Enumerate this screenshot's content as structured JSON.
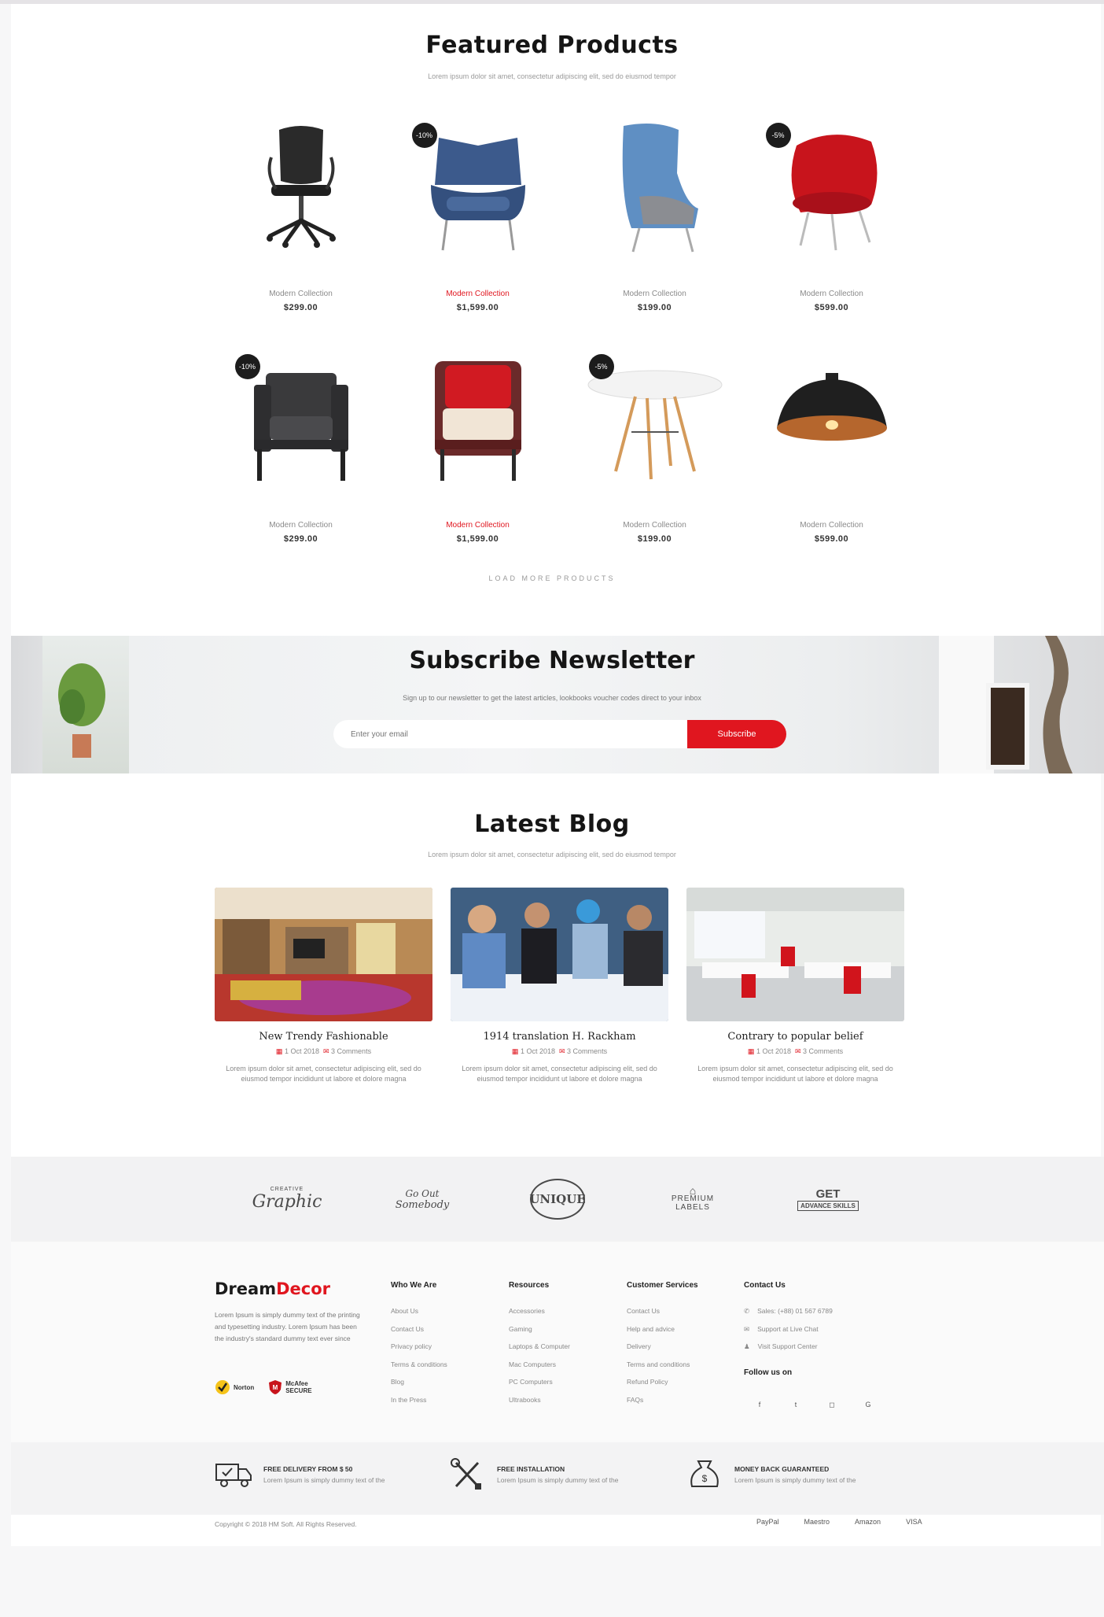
{
  "featured": {
    "title": "Featured Products",
    "subtitle": "Lorem ipsum dolor sit amet, consectetur adipiscing elit, sed do eiusmod tempor",
    "products": [
      {
        "name": "Modern Collection",
        "price": "$299.00",
        "badge": "",
        "highlight": false,
        "icon": "office-chair"
      },
      {
        "name": "Modern Collection",
        "price": "$1,599.00",
        "badge": "-10%",
        "highlight": true,
        "icon": "blue-wingback-chair"
      },
      {
        "name": "Modern Collection",
        "price": "$199.00",
        "badge": "",
        "highlight": false,
        "icon": "blue-egg-chair"
      },
      {
        "name": "Modern Collection",
        "price": "$599.00",
        "badge": "-5%",
        "highlight": false,
        "icon": "red-womb-chair"
      },
      {
        "name": "Modern Collection",
        "price": "$299.00",
        "badge": "-10%",
        "highlight": false,
        "icon": "leather-armchair"
      },
      {
        "name": "Modern Collection",
        "price": "$1,599.00",
        "badge": "",
        "highlight": true,
        "icon": "red-upholstered-armchair"
      },
      {
        "name": "Modern Collection",
        "price": "$199.00",
        "badge": "-5%",
        "highlight": false,
        "icon": "white-round-table"
      },
      {
        "name": "Modern Collection",
        "price": "$599.00",
        "badge": "",
        "highlight": false,
        "icon": "pendant-lamp"
      }
    ],
    "load_more": "LOAD MORE PRODUCTS"
  },
  "newsletter": {
    "title": "Subscribe Newsletter",
    "subtitle": "Sign up to our newsletter to get the latest articles, lookbooks voucher codes direct to your inbox",
    "placeholder": "Enter your email",
    "button": "Subscribe"
  },
  "blog": {
    "title": "Latest Blog",
    "subtitle": "Lorem ipsum dolor sit amet, consectetur adipiscing elit, sed do eiusmod tempor",
    "posts": [
      {
        "title": "New Trendy Fashionable",
        "date": "1 Oct 2018",
        "comments": "3 Comments",
        "excerpt": "Lorem ipsum dolor sit amet, consectetur adipiscing elit, sed do eiusmod tempor incididunt ut labore et dolore magna"
      },
      {
        "title": "1914 translation H. Rackham",
        "date": "1 Oct 2018",
        "comments": "3 Comments",
        "excerpt": "Lorem ipsum dolor sit amet, consectetur adipiscing elit, sed do eiusmod tempor incididunt ut labore et dolore magna"
      },
      {
        "title": "Contrary to popular belief",
        "date": "1 Oct 2018",
        "comments": "3 Comments",
        "excerpt": "Lorem ipsum dolor sit amet, consectetur adipiscing elit, sed do eiusmod tempor incididunt ut labore et dolore magna"
      }
    ]
  },
  "brands": [
    {
      "top": "CREATIVE",
      "main": "Graphic"
    },
    {
      "top": "Go Out",
      "main": "Somebody"
    },
    {
      "top": "",
      "main": "UNIQUE"
    },
    {
      "top": "",
      "main": "PREMIUM LABELS"
    },
    {
      "top": "GET",
      "main": "ADVANCE SKILLS"
    }
  ],
  "footer": {
    "logo_main": "Dream",
    "logo_accent": "Decor",
    "about": "Lorem Ipsum is simply dummy text of the printing and typesetting industry. Lorem Ipsum has been the industry's standard dummy text ever since",
    "seal_norton": "Norton",
    "seal_mcafee": "McAfee SECURE",
    "columns": [
      {
        "title": "Who We Are",
        "links": [
          "About Us",
          "Contact Us",
          "Privacy policy",
          "Terms & conditions",
          "Blog",
          "In the Press"
        ]
      },
      {
        "title": "Resources",
        "links": [
          "Accessories",
          "Gaming",
          "Laptops & Computer",
          "Mac Computers",
          "PC Computers",
          "Ultrabooks"
        ]
      },
      {
        "title": "Customer Services",
        "links": [
          "Contact Us",
          "Help and advice",
          "Delivery",
          "Terms and conditions",
          "Refund Policy",
          "FAQs"
        ]
      }
    ],
    "contact_title": "Contact Us",
    "contact": [
      {
        "icon": "phone-icon",
        "text": "Sales: (+88) 01 567 6789"
      },
      {
        "icon": "chat-icon",
        "text": "Support at Live Chat"
      },
      {
        "icon": "user-icon",
        "text": "Visit Support Center"
      }
    ],
    "follow_title": "Follow us on",
    "social": [
      {
        "icon": "facebook-icon",
        "glyph": "f"
      },
      {
        "icon": "twitter-icon",
        "glyph": "t"
      },
      {
        "icon": "instagram-icon",
        "glyph": "◻"
      },
      {
        "icon": "google-icon",
        "glyph": "G"
      }
    ]
  },
  "features": [
    {
      "title": "FREE DELIVERY FROM $ 50",
      "text": "Lorem Ipsum is simply dummy text of the"
    },
    {
      "title": "FREE INSTALLATION",
      "text": "Lorem Ipsum is simply dummy text of the"
    },
    {
      "title": "MONEY BACK GUARANTEED",
      "text": "Lorem Ipsum is simply dummy text of the"
    }
  ],
  "copyright": "Copyright © 2018 HM Soft. All Rights Reserved.",
  "payments": [
    "PayPal",
    "Maestro",
    "Amazon",
    "VISA"
  ],
  "colors": {
    "accent": "#e0161f",
    "dark": "#1b1b1b"
  }
}
